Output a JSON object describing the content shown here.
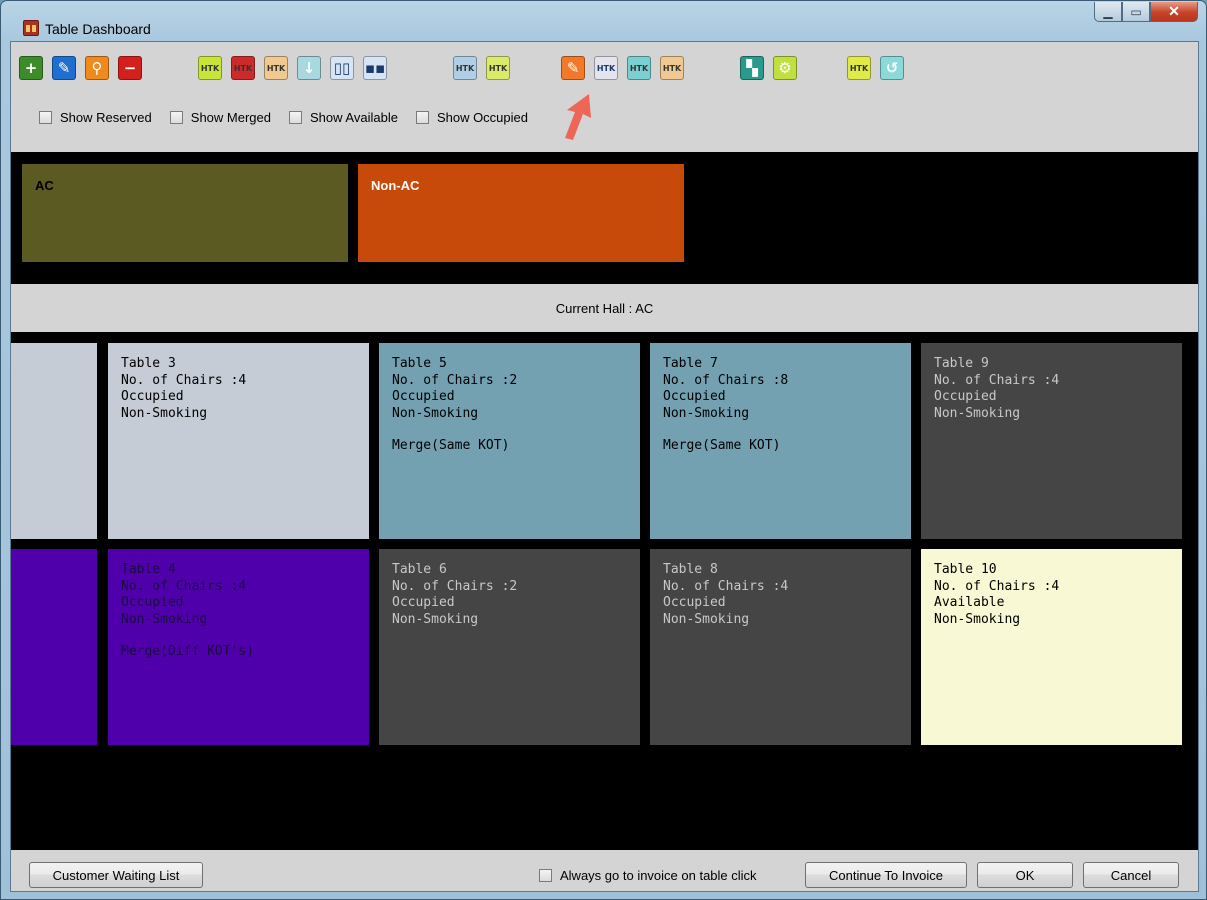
{
  "window": {
    "title": "Table Dashboard"
  },
  "toolbar": {
    "icons": [
      {
        "name": "add-icon",
        "glyph": "+",
        "bg": "#3d8c2a"
      },
      {
        "name": "edit-icon",
        "glyph": "✎",
        "bg": "#1f6fd0"
      },
      {
        "name": "search-icon",
        "glyph": "⚲",
        "bg": "#f08a1c"
      },
      {
        "name": "delete-icon",
        "glyph": "−",
        "bg": "#d4201d"
      },
      {
        "name": "table-ok-icon",
        "glyph": "HTK",
        "bg": "#c8e63a"
      },
      {
        "name": "table-red-icon",
        "glyph": "HTK",
        "bg": "#cc2b2b"
      },
      {
        "name": "table-cancel-icon",
        "glyph": "HTK",
        "bg": "#f0c890"
      },
      {
        "name": "table-download-icon",
        "glyph": "↓",
        "bg": "#a8d8e0"
      },
      {
        "name": "split-table-icon",
        "glyph": "▯▯",
        "bg": "#d6e4f4"
      },
      {
        "name": "single-table-icon",
        "glyph": "▪▪",
        "bg": "#d6e4f4"
      },
      {
        "name": "table-occupied-icon",
        "glyph": "HTK",
        "bg": "#b0cfe6"
      },
      {
        "name": "table-check-icon",
        "glyph": "HTK",
        "bg": "#dcea6a"
      },
      {
        "name": "edit-note-icon",
        "glyph": "✎",
        "bg": "#f07a2a"
      },
      {
        "name": "table-line-icon",
        "glyph": "HTK",
        "bg": "#e4e4ee"
      },
      {
        "name": "table-add-icon",
        "glyph": "HTK",
        "bg": "#7ad0d0"
      },
      {
        "name": "table-list-icon",
        "glyph": "HTK",
        "bg": "#f0c890"
      },
      {
        "name": "layout-color-icon",
        "glyph": "▚",
        "bg": "#2a9a8a"
      },
      {
        "name": "settings-gear-icon",
        "glyph": "⚙",
        "bg": "#c0e040"
      },
      {
        "name": "table-merge-icon",
        "glyph": "HTK",
        "bg": "#e0ea48"
      },
      {
        "name": "table-swap-icon",
        "glyph": "↺",
        "bg": "#8adada"
      }
    ],
    "filters": [
      "Show Reserved",
      "Show Merged",
      "Show Available",
      "Show Occupied"
    ]
  },
  "halls": [
    {
      "name": "AC",
      "bg": "#5b5a23",
      "color": "#000000"
    },
    {
      "name": "Non-AC",
      "bg": "#c84a0b",
      "color": "#ffffff"
    }
  ],
  "current_hall": "Current Hall : AC",
  "tables": [
    {
      "name": "Table 3",
      "chairs": "No. of Chairs :4",
      "status": "Occupied",
      "smoking": "Non-Smoking",
      "merge": "",
      "bg": "#c5ccd6",
      "color": "#000000"
    },
    {
      "name": "Table 5",
      "chairs": "No. of Chairs :2",
      "status": "Occupied",
      "smoking": "Non-Smoking",
      "merge": "Merge(Same KOT)",
      "bg": "#73a1b1",
      "color": "#000000"
    },
    {
      "name": "Table 7",
      "chairs": "No. of Chairs :8",
      "status": "Occupied",
      "smoking": "Non-Smoking",
      "merge": "Merge(Same KOT)",
      "bg": "#73a1b1",
      "color": "#000000"
    },
    {
      "name": "Table 9",
      "chairs": "No. of Chairs :4",
      "status": "Occupied",
      "smoking": "Non-Smoking",
      "merge": "",
      "bg": "#454545",
      "color": "#c8c8c8"
    },
    {
      "name": "Table 4",
      "chairs": "No. of Chairs :4",
      "status": "Occupied",
      "smoking": "Non-Smoking",
      "merge": "Merge(Diff KOT's)",
      "bg": "#5000aa",
      "color": "#1a0b44"
    },
    {
      "name": "Table 6",
      "chairs": "No. of Chairs :2",
      "status": "Occupied",
      "smoking": "Non-Smoking",
      "merge": "",
      "bg": "#454545",
      "color": "#c8c8c8"
    },
    {
      "name": "Table 8",
      "chairs": "No. of Chairs :4",
      "status": "Occupied",
      "smoking": "Non-Smoking",
      "merge": "",
      "bg": "#454545",
      "color": "#c8c8c8"
    },
    {
      "name": "Table 10",
      "chairs": "No. of Chairs :4",
      "status": "Available",
      "smoking": "Non-Smoking",
      "merge": "",
      "bg": "#f8f8d4",
      "color": "#000000"
    }
  ],
  "partial_tiles": [
    {
      "bg": "#c5ccd6"
    },
    {
      "bg": "#5000aa"
    }
  ],
  "footer": {
    "waiting_list": "Customer Waiting List",
    "always_invoice": "Always go to invoice on table click",
    "continue": "Continue To Invoice",
    "ok": "OK",
    "cancel": "Cancel"
  }
}
